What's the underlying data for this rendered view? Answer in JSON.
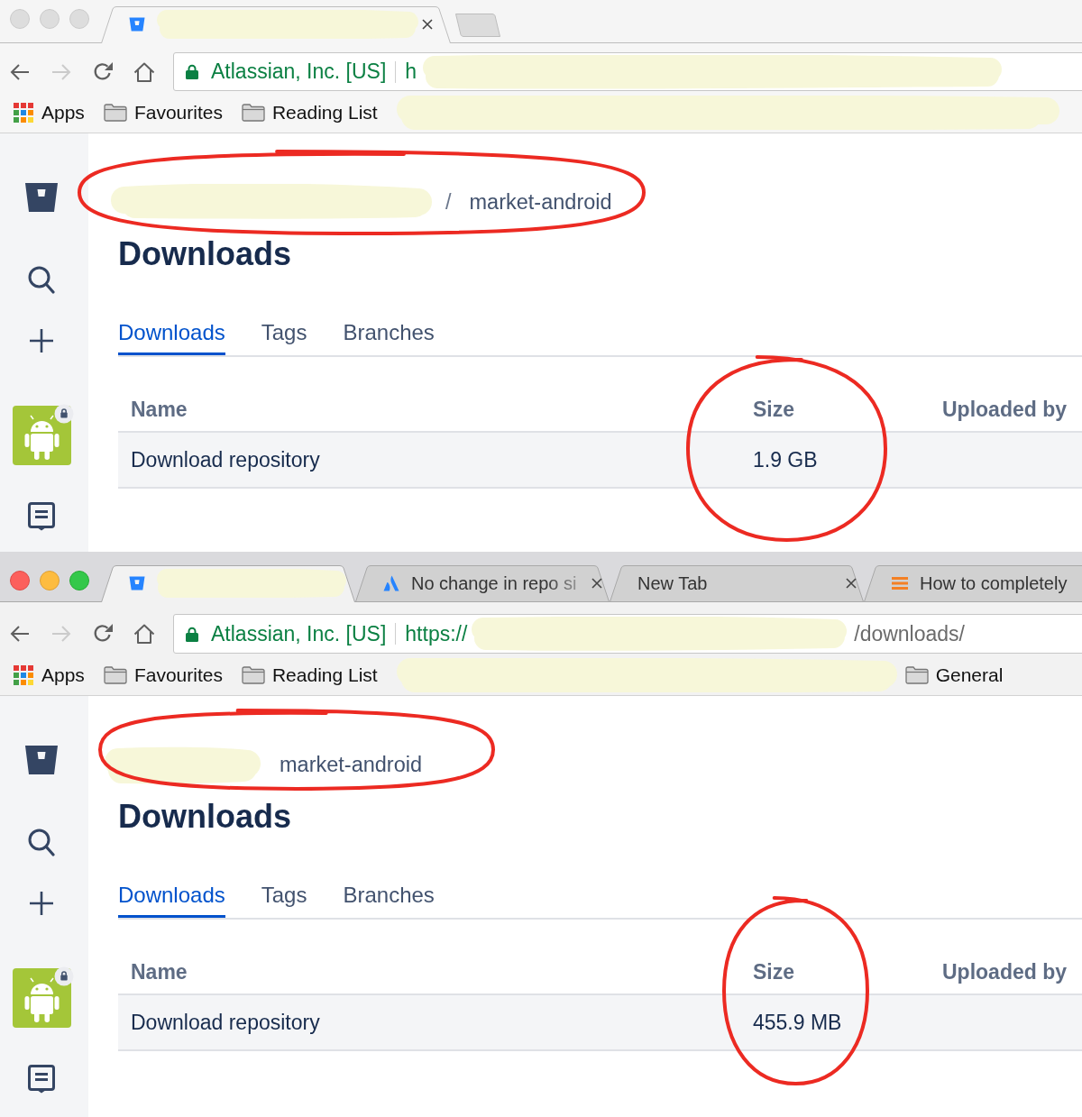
{
  "windows": [
    {
      "focused": false,
      "tabs": [
        {
          "favicon": {
            "kind": "bitbucket"
          },
          "selected": true,
          "closable": true,
          "faded": false
        }
      ],
      "new_tab_button": true,
      "nav_buttons": [
        {
          "kind": "back",
          "disabled": false
        },
        {
          "kind": "forward",
          "disabled": true
        },
        {
          "kind": "reload",
          "disabled": false
        },
        {
          "kind": "home",
          "disabled": false
        }
      ],
      "omnibox": {
        "secure": true,
        "identity": "Atlassian, Inc. [US]",
        "url_start": "h"
      },
      "bookmarks": [
        {
          "kind": "apps",
          "label": "Apps"
        },
        {
          "kind": "folder",
          "label": "Favourites"
        },
        {
          "kind": "folder",
          "label": "Reading List"
        }
      ],
      "sidebar": {
        "repository_locked": true
      },
      "page": {
        "breadcrumb": {
          "separator": "/",
          "repository": "market-android",
          "circled": true
        },
        "heading": "Downloads",
        "tabs": [
          {
            "label": "Downloads",
            "selected": true
          },
          {
            "label": "Tags",
            "selected": false
          },
          {
            "label": "Branches",
            "selected": false
          }
        ],
        "table": {
          "columns": [
            {
              "label": "Name",
              "circled": false
            },
            {
              "label": "Size",
              "circled": true
            },
            {
              "label": "Uploaded by",
              "circled": false
            }
          ],
          "rows": [
            [
              "Download repository",
              "1.9 GB"
            ]
          ]
        }
      }
    },
    {
      "focused": true,
      "tabs": [
        {
          "favicon": {
            "kind": "bitbucket"
          },
          "selected": true,
          "closable": false,
          "faded": false
        },
        {
          "favicon": {
            "kind": "atlassian"
          },
          "title": "No change in repo si",
          "selected": false,
          "closable": true,
          "faded": true
        },
        {
          "title": "New Tab",
          "selected": false,
          "closable": true,
          "faded": false
        },
        {
          "favicon": {
            "kind": "lines"
          },
          "title": "How to completely",
          "selected": false,
          "faded": false
        }
      ],
      "new_tab_button": false,
      "nav_buttons": [
        {
          "kind": "back",
          "disabled": false
        },
        {
          "kind": "forward",
          "disabled": true
        },
        {
          "kind": "reload",
          "disabled": false
        },
        {
          "kind": "home",
          "disabled": false
        }
      ],
      "omnibox": {
        "secure": true,
        "identity": "Atlassian, Inc. [US]",
        "url_start": "https://",
        "url_end": "/downloads/"
      },
      "bookmarks": [
        {
          "kind": "apps",
          "label": "Apps"
        },
        {
          "kind": "folder",
          "label": "Favourites"
        },
        {
          "kind": "folder",
          "label": "Reading List"
        },
        {
          "kind": "folder",
          "label": "General"
        }
      ],
      "sidebar": {
        "repository_locked": true
      },
      "page": {
        "breadcrumb": {
          "repository": "market-android",
          "circled": true
        },
        "heading": "Downloads",
        "tabs": [
          {
            "label": "Downloads",
            "selected": true
          },
          {
            "label": "Tags",
            "selected": false
          },
          {
            "label": "Branches",
            "selected": false
          }
        ],
        "table": {
          "columns": [
            {
              "label": "Name",
              "circled": false
            },
            {
              "label": "Size",
              "circled": true
            },
            {
              "label": "Uploaded by",
              "circled": false
            }
          ],
          "rows": [
            [
              "Download repository",
              "455.9 MB"
            ]
          ]
        }
      }
    }
  ]
}
